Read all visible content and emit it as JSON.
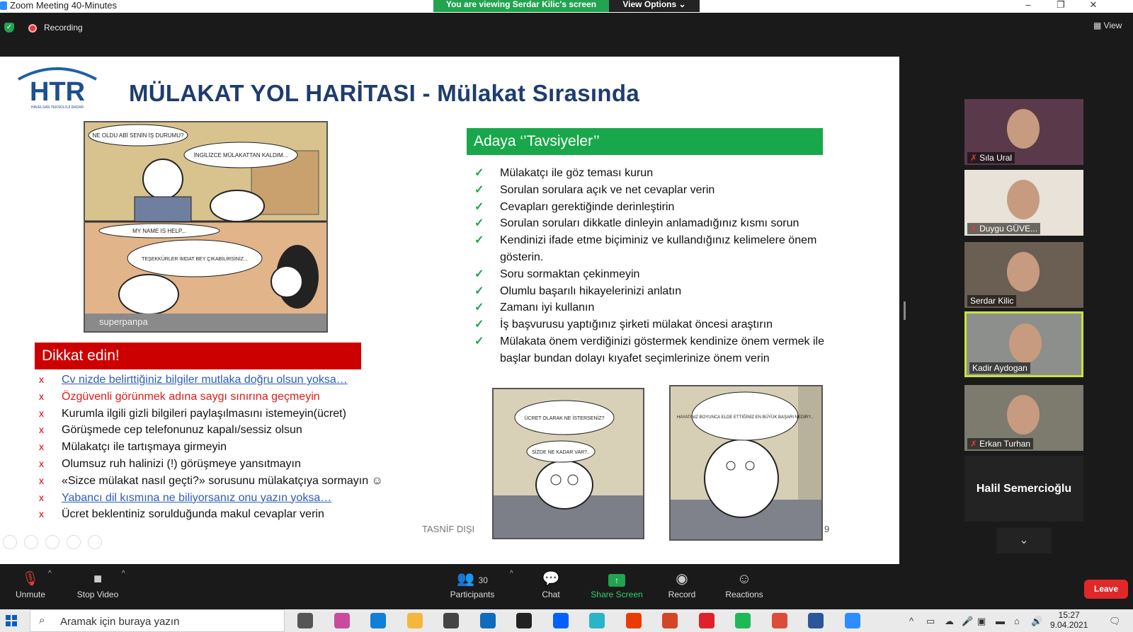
{
  "window": {
    "title": "Zoom Meeting 40-Minutes",
    "banner": "You are viewing Serdar Kilic's screen",
    "view_options": "View Options",
    "view_options_caret": "⌄",
    "minimize": "–",
    "restore": "❐",
    "close": "✕"
  },
  "meeting_bar": {
    "recording": "Recording",
    "view": "View"
  },
  "slide": {
    "logo_text": "HTR",
    "logo_subtext": "HAVELSAN TEKNOLOJİ RADAR",
    "title": "MÜLAKAT YOL HARİTASI - Mülakat Sırasında",
    "cartoon_main": {
      "bubble1": "NE OLDU ABİ SENİN İŞ DURUMU?",
      "bubble2": "İNGİLİZCE MÜLAKATTAN KALDIM...",
      "bubble3": "MY NAME IS HELP...",
      "bubble4": "TEŞEKKÜRLER İMDAT BEY ÇIKABİLİRSİNİZ...",
      "signature": "superpanpa"
    },
    "cartoon_a": {
      "bubble1": "ÜCRET OLARAK NE İSTERSENİZ?",
      "bubble2": "SİZDE NE KADAR VAR?.."
    },
    "cartoon_b": {
      "bubble1": "HAYATINIZ BOYUNCA ELDE ETTİĞİNİZ EN BÜYÜK BAŞARI NEDİR?.."
    },
    "dikkat": {
      "header": "Dikkat edin!",
      "mark": "x",
      "items": [
        {
          "text": "Cv nizde belirttiğiniz bilgiler mutlaka doğru olsun yoksa…",
          "style": "link"
        },
        {
          "text": "Özgüvenli görünmek adına saygı sınırına geçmeyin",
          "style": "red"
        },
        {
          "text": "Kurumla ilgili gizli bilgileri paylaşılmasını istemeyin(ücret)",
          "style": "normal"
        },
        {
          "text": "Görüşmede cep telefonunuz kapalı/sessiz olsun",
          "style": "normal"
        },
        {
          "text": "Mülakatçı ile tartışmaya girmeyin",
          "style": "normal"
        },
        {
          "text": "Olumsuz ruh halinizi (!) görüşmeye yansıtmayın",
          "style": "normal"
        },
        {
          "text": "«Sizce mülakat nasıl geçti?» sorusunu mülakatçıya sormayın ☺",
          "style": "normal"
        },
        {
          "text": "Yabancı dil kısmına ne biliyorsanız onu yazın yoksa…",
          "style": "link"
        },
        {
          "text": "Ücret beklentiniz sorulduğunda makul cevaplar verin",
          "style": "normal"
        }
      ]
    },
    "advice": {
      "header": "Adaya ‘’Tavsiyeler’’",
      "mark": "✓",
      "items": [
        "Mülakatçı ile göz teması kurun",
        "Sorulan sorulara açık ve net cevaplar verin",
        "Cevapları gerektiğinde derinleştirin",
        "Sorulan soruları dikkatle dinleyin anlamadığınız kısmı sorun",
        "Kendinizi ifade etme biçiminiz ve kullandığınız kelimelere önem gösterin.",
        "Soru sormaktan çekinmeyin",
        "Olumlu başarılı hikayelerinizi anlatın",
        "Zamanı iyi kullanın",
        "İş başvurusu yaptığınız şirketi mülakat öncesi araştırın",
        "Mülakata önem verdiğinizi göstermek kendinize önem vermek ile başlar bundan dolayı kıyafet seçimlerinize önem verin"
      ]
    },
    "footer_label": "TASNİF DIŞI",
    "page_number": "9"
  },
  "participants_panel": {
    "tiles": [
      {
        "name": "Sıla Ural",
        "muted": true,
        "active": false
      },
      {
        "name": "Duygu GÜVE...",
        "muted": true,
        "active": false
      },
      {
        "name": "Serdar Kilic",
        "muted": false,
        "active": false
      },
      {
        "name": "Kadir Aydogan",
        "muted": false,
        "active": true
      },
      {
        "name": "Erkan Turhan",
        "muted": true,
        "active": false
      }
    ],
    "text_tile": "Halil Semercioğlu",
    "scroll": "⌄"
  },
  "toolbar": {
    "unmute": "Unmute",
    "stop_video": "Stop Video",
    "participants": "Participants",
    "participants_count": "30",
    "chat": "Chat",
    "share_screen": "Share Screen",
    "record": "Record",
    "reactions": "Reactions",
    "leave": "Leave",
    "caret": "^",
    "share_arrow": "↑"
  },
  "taskbar": {
    "search_placeholder": "Aramak için buraya yazın",
    "time": "15:27",
    "date": "9.04.2021",
    "app_colors": [
      "#555555",
      "#c84b9e",
      "#0f7fd8",
      "#f3b83b",
      "#444444",
      "#0f6cbd",
      "#222222",
      "#0061fe",
      "#2bb3c7",
      "#eb3c00",
      "#d24726",
      "#e0202a",
      "#1db954",
      "#dd4b39",
      "#2b579a",
      "#2d8cff"
    ]
  }
}
